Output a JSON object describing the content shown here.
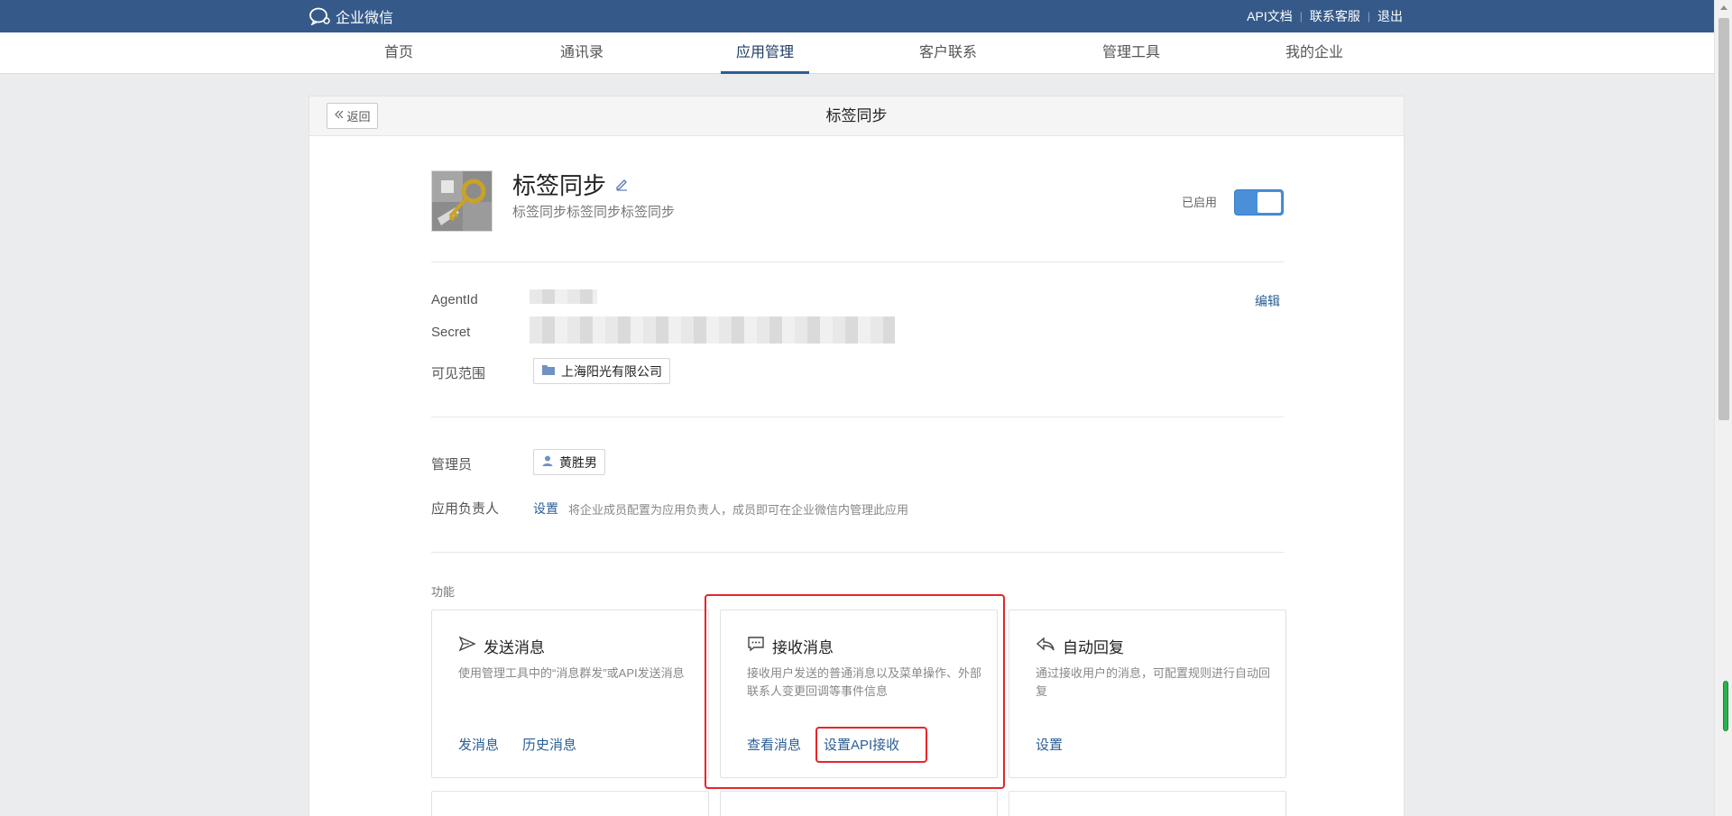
{
  "topbar": {
    "logo_text": "企业微信",
    "links": [
      "API文档",
      "联系客服",
      "退出"
    ]
  },
  "nav": {
    "items": [
      "首页",
      "通讯录",
      "应用管理",
      "客户联系",
      "管理工具",
      "我的企业"
    ],
    "active": "应用管理"
  },
  "page": {
    "back_label": "返回",
    "title": "标签同步"
  },
  "app": {
    "name": "标签同步",
    "description": "标签同步标签同步标签同步",
    "status_label": "已启用",
    "enabled": true
  },
  "info": {
    "agentid_label": "AgentId",
    "secret_label": "Secret",
    "visible_range_label": "可见范围",
    "visible_range_value": "上海阳光有限公司",
    "edit_label": "编辑"
  },
  "admins": {
    "admin_label": "管理员",
    "admin_name": "黄胜男",
    "owner_label": "应用负责人",
    "owner_set": "设置",
    "owner_hint": "将企业成员配置为应用负责人，成员即可在企业微信内管理此应用"
  },
  "functions": {
    "title": "功能",
    "cards": [
      {
        "title": "发送消息",
        "icon": "send-icon",
        "desc": "使用管理工具中的“消息群发”或API发送消息",
        "actions": [
          "发消息",
          "历史消息"
        ]
      },
      {
        "title": "接收消息",
        "icon": "chat-bubble-icon",
        "desc": "接收用户发送的普通消息以及菜单操作、外部联系人变更回调等事件信息",
        "actions": [
          "查看消息",
          "设置API接收"
        ]
      },
      {
        "title": "自动回复",
        "icon": "reply-icon",
        "desc": "通过接收用户的消息，可配置规则进行自动回复",
        "actions": [
          "设置"
        ]
      }
    ]
  },
  "colors": {
    "topbar": "#355a8a",
    "link": "#2b5e96",
    "highlight": "#e5262a",
    "toggle": "#4a90d9"
  }
}
